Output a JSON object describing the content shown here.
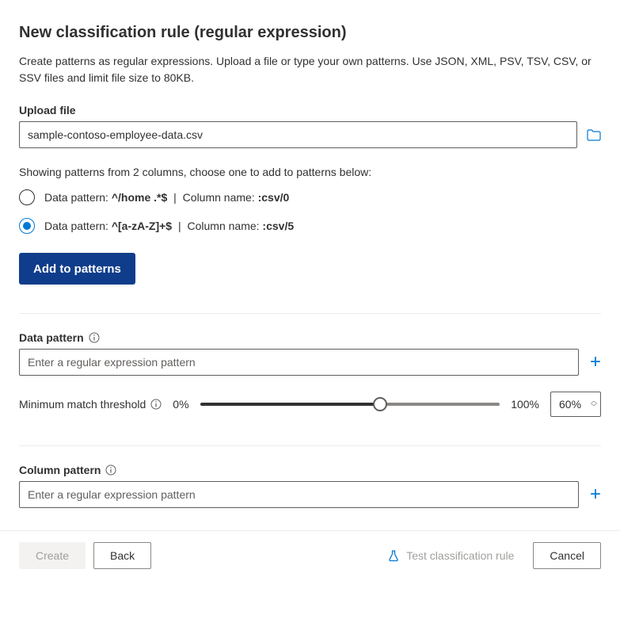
{
  "title": "New classification rule (regular expression)",
  "description": "Create patterns as regular expressions. Upload a file or type your own patterns. Use JSON, XML, PSV, TSV, CSV, or SSV files and limit file size to 80KB.",
  "upload": {
    "label": "Upload file",
    "value": "sample-contoso-employee-data.csv"
  },
  "patterns_info": "Showing patterns from 2 columns, choose one to add to patterns below:",
  "pattern_options": [
    {
      "prefix": "Data pattern: ",
      "pattern": "^/home .*$",
      "sep": " | ",
      "col_prefix": "Column name: ",
      "column": ":csv/0",
      "selected": false
    },
    {
      "prefix": "Data pattern: ",
      "pattern": "^[a-zA-Z]+$",
      "sep": " | ",
      "col_prefix": "Column name: ",
      "column": ":csv/5",
      "selected": true
    }
  ],
  "add_button": "Add to patterns",
  "data_pattern": {
    "label": "Data pattern",
    "placeholder": "Enter a regular expression pattern"
  },
  "threshold": {
    "label": "Minimum match threshold",
    "min": "0%",
    "max": "100%",
    "value": "60%"
  },
  "column_pattern": {
    "label": "Column pattern",
    "placeholder": "Enter a regular expression pattern"
  },
  "footer": {
    "create": "Create",
    "back": "Back",
    "test": "Test classification rule",
    "cancel": "Cancel"
  }
}
